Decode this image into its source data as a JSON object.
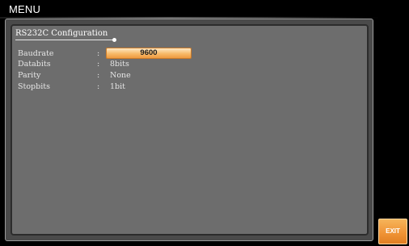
{
  "header": {
    "title": "MENU"
  },
  "section": {
    "title": "RS232C Configuration"
  },
  "settings": [
    {
      "label": "Baudrate",
      "separator": ":",
      "value": "9600",
      "selected": true
    },
    {
      "label": "Databits",
      "separator": ":",
      "value": "8bits",
      "selected": false
    },
    {
      "label": "Parity",
      "separator": ":",
      "value": "None",
      "selected": false
    },
    {
      "label": "Stopbits",
      "separator": ":",
      "value": "1bit",
      "selected": false
    }
  ],
  "softkeys": {
    "exit_label": "EXIT"
  },
  "colors": {
    "background": "#000000",
    "panel": "#6d6d6d",
    "highlight": "#f7b968",
    "exit_button": "#ef9234"
  }
}
